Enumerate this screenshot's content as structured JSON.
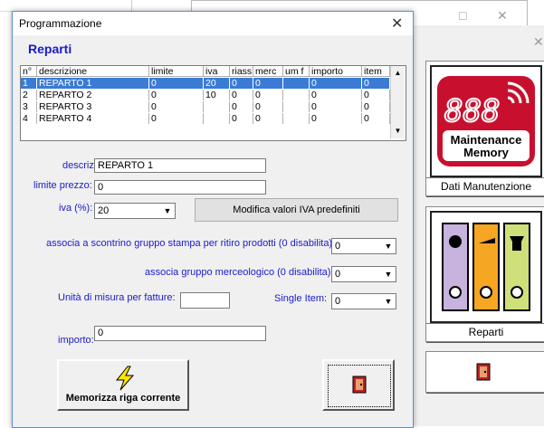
{
  "background": {
    "tile_maintenance_caption": "Dati Manutenzione",
    "tile_maintenance_logo_digits": "888",
    "tile_maintenance_logo_line1": "Maintenance",
    "tile_maintenance_logo_line2": "Memory",
    "tile_reparti_caption": "Reparti",
    "win_minimize": "□",
    "win_close": "✕"
  },
  "dialog": {
    "title": "Programmazione",
    "close_glyph": "✕",
    "section_title": "Reparti",
    "table": {
      "columns": [
        "n°",
        "descrizione",
        "limite",
        "iva",
        "riass.",
        "merc",
        "um f",
        "importo",
        "item"
      ],
      "rows": [
        [
          "1",
          "REPARTO 1",
          "0",
          "20",
          "0",
          "0",
          "",
          "0",
          "0"
        ],
        [
          "2",
          "REPARTO 2",
          "0",
          "10",
          "0",
          "0",
          "",
          "0",
          "0"
        ],
        [
          "3",
          "REPARTO 3",
          "0",
          "",
          "0",
          "0",
          "",
          "0",
          "0"
        ],
        [
          "4",
          "REPARTO 4",
          "0",
          "",
          "0",
          "0",
          "",
          "0",
          "0"
        ]
      ],
      "selected_row": 1,
      "scroll_up": "▲",
      "scroll_down": "▼"
    },
    "form": {
      "descrizione_label": "descrizione:",
      "descrizione_value": "REPARTO 1",
      "limite_label": "limite prezzo:",
      "limite_value": "0",
      "iva_label": "iva (%):",
      "iva_value": "20",
      "modifica_iva_button": "Modifica valori IVA predefiniti",
      "scontrino_label": "associa a scontrino gruppo stampa per ritiro prodotti (0 disabilita):",
      "scontrino_value": "0",
      "merceologico_label": "associa gruppo merceologico (0 disabilita):",
      "merceologico_value": "0",
      "unita_label": "Unità di misura per fatture:",
      "unita_value": "",
      "single_item_label": "Single Item:",
      "single_item_value": "0",
      "importo_label": "importo:",
      "importo_value": "0",
      "dropdown_arrow": "▼"
    },
    "buttons": {
      "memorizza": "Memorizza riga corrente"
    }
  }
}
